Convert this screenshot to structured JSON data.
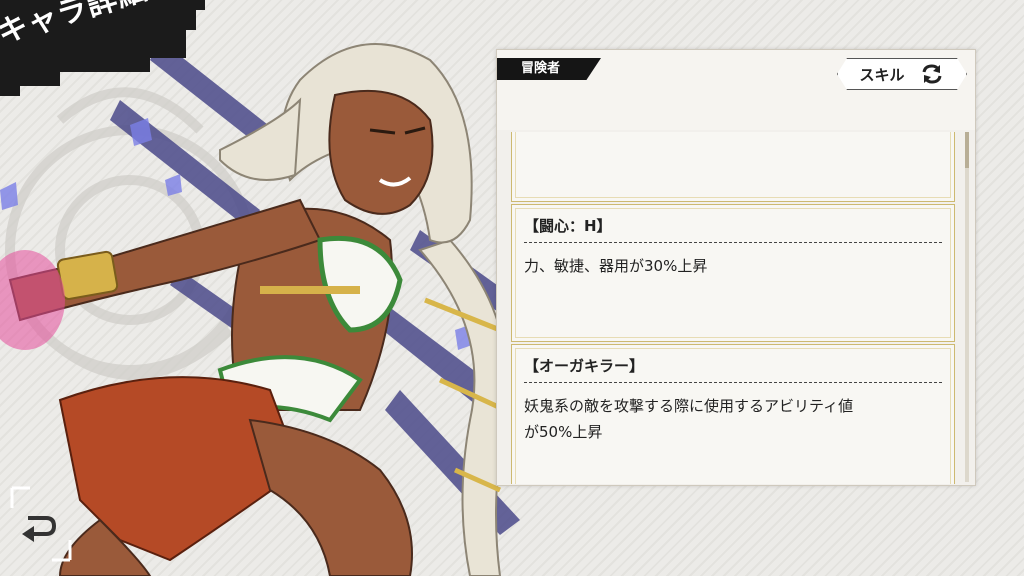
{
  "header": {
    "title": "キャラ詳細"
  },
  "panel": {
    "rank_label": "冒険者",
    "skill_button_label": "スキル",
    "skills": [
      {
        "name": "【闘心：H】",
        "description": "力、敏捷、器用が30%上昇"
      },
      {
        "name": "【オーガキラー】",
        "description_lines": [
          "妖鬼系の敵を攻撃する際に使用するアビリティ値",
          "が50%上昇"
        ]
      }
    ]
  },
  "icons": {
    "refresh": "refresh-arrows-icon",
    "back": "return-arrow-icon"
  },
  "colors": {
    "accent_dark": "#1b1b1b",
    "card_border_gold": "#cdb970",
    "panel_bg": "#f2f0ec"
  }
}
